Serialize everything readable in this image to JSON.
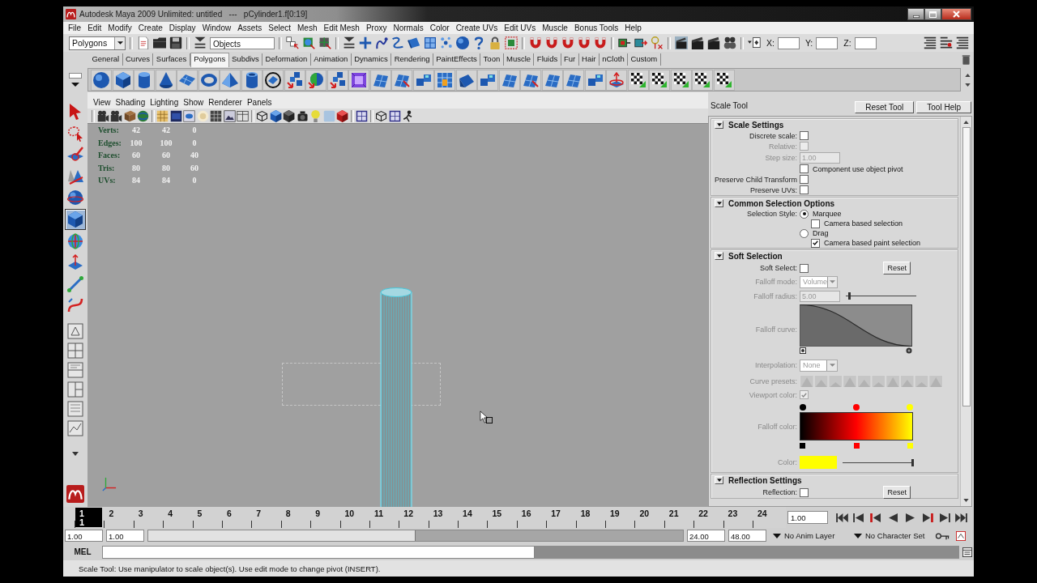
{
  "window": {
    "title": "Autodesk Maya 2009 Unlimited: untitled   ---   pCylinder1.f[0:19]"
  },
  "menu_bar": [
    "File",
    "Edit",
    "Modify",
    "Create",
    "Display",
    "Window",
    "Assets",
    "Select",
    "Mesh",
    "Edit Mesh",
    "Proxy",
    "Normals",
    "Color",
    "Create UVs",
    "Edit UVs",
    "Muscle",
    "Bonus Tools",
    "Help"
  ],
  "status_line": {
    "menu_set": "Polygons",
    "selection_mode": "Objects",
    "coordinate_labels": [
      "X:",
      "Y:",
      "Z:"
    ]
  },
  "shelf": {
    "tabs": [
      {
        "label": "General",
        "selected": false
      },
      {
        "label": "Curves",
        "selected": false
      },
      {
        "label": "Surfaces",
        "selected": false
      },
      {
        "label": "Polygons",
        "selected": true
      },
      {
        "label": "Subdivs",
        "selected": false
      },
      {
        "label": "Deformation",
        "selected": false
      },
      {
        "label": "Animation",
        "selected": false
      },
      {
        "label": "Dynamics",
        "selected": false
      },
      {
        "label": "Rendering",
        "selected": false
      },
      {
        "label": "PaintEffects",
        "selected": false
      },
      {
        "label": "Toon",
        "selected": false
      },
      {
        "label": "Muscle",
        "selected": false
      },
      {
        "label": "Fluids",
        "selected": false
      },
      {
        "label": "Fur",
        "selected": false
      },
      {
        "label": "Hair",
        "selected": false
      },
      {
        "label": "nCloth",
        "selected": false
      },
      {
        "label": "Custom",
        "selected": false
      }
    ]
  },
  "toolbox": {
    "tools": [
      {
        "selected": false
      },
      {
        "selected": false
      },
      {
        "selected": false
      },
      {
        "selected": false
      },
      {
        "selected": false
      },
      {
        "selected": true
      },
      {
        "selected": false
      },
      {
        "selected": false
      },
      {
        "selected": false
      },
      {
        "selected": false
      }
    ]
  },
  "viewport": {
    "menu": [
      "View",
      "Shading",
      "Lighting",
      "Show",
      "Renderer",
      "Panels"
    ],
    "stats": [
      {
        "label": "Verts:",
        "values": [
          "42",
          "42",
          "0"
        ]
      },
      {
        "label": "Edges:",
        "values": [
          "100",
          "100",
          "0"
        ]
      },
      {
        "label": "Faces:",
        "values": [
          "60",
          "60",
          "40"
        ]
      },
      {
        "label": "Tris:",
        "values": [
          "80",
          "80",
          "60"
        ]
      },
      {
        "label": "UVs:",
        "values": [
          "84",
          "84",
          "0"
        ]
      }
    ]
  },
  "tool_settings": {
    "title": "Scale Tool",
    "buttons": [
      "Reset Tool",
      "Tool Help"
    ],
    "sections": [
      {
        "title": "Scale Settings",
        "expanded": true,
        "rows": [
          {
            "kind": "checkbox",
            "label": "Discrete scale:",
            "checked": false,
            "disabled": false
          },
          {
            "kind": "checkbox",
            "label": "Relative:",
            "checked": false,
            "disabled": true
          },
          {
            "kind": "field",
            "label": "Step size:",
            "value": "1.00",
            "disabled": true
          },
          {
            "kind": "option",
            "text": "Component use object pivot",
            "checked": false,
            "disabled": false
          },
          {
            "kind": "checkbox",
            "label": "Preserve Child Transform",
            "checked": false,
            "disabled": false
          },
          {
            "kind": "checkbox",
            "label": "Preserve UVs:",
            "checked": false,
            "disabled": false
          }
        ]
      },
      {
        "title": "Common Selection Options",
        "expanded": true,
        "rows": [
          {
            "kind": "radio",
            "label": "Selection Style:",
            "text": "Marquee",
            "selected": true,
            "disabled": false
          },
          {
            "kind": "sub_option",
            "text": "Camera based selection",
            "checked": false,
            "disabled": false
          },
          {
            "kind": "radio",
            "text": "Drag",
            "selected": false,
            "disabled": false
          },
          {
            "kind": "sub_option",
            "text": "Camera based paint selection",
            "checked": true,
            "disabled": false
          }
        ]
      },
      {
        "title": "Soft Selection",
        "expanded": true,
        "rows": [
          {
            "kind": "checkbox",
            "label": "Soft Select:",
            "checked": false,
            "disabled": false,
            "button": "Reset"
          },
          {
            "kind": "dropdown",
            "label": "Falloff mode:",
            "value": "Volume",
            "disabled": true
          },
          {
            "kind": "slider_field",
            "label": "Falloff radius:",
            "value": "5.00",
            "level": 0.05,
            "disabled": true
          },
          {
            "kind": "curve",
            "label": "Falloff curve:",
            "disabled": true
          },
          {
            "kind": "dropdown",
            "label": "Interpolation:",
            "value": "None",
            "disabled": true
          },
          {
            "kind": "presets",
            "label": "Curve presets:",
            "disabled": true
          },
          {
            "kind": "checkbox",
            "label": "Viewport color:",
            "checked": true,
            "disabled": true
          },
          {
            "kind": "gradient",
            "label": "Falloff color:",
            "stops": [
              {
                "color": "#000000"
              },
              {
                "color": "#ff0000"
              },
              {
                "color": "#ffff00"
              }
            ],
            "disabled": true
          },
          {
            "kind": "color_slider",
            "label": "Color:",
            "color": "#ffff00",
            "level": 1,
            "disabled": true
          }
        ]
      },
      {
        "title": "Reflection Settings",
        "expanded": true,
        "rows": [
          {
            "kind": "checkbox",
            "label": "Reflection:",
            "checked": false,
            "disabled": false,
            "button": "Reset"
          }
        ]
      }
    ]
  },
  "time_slider": {
    "frames": [
      {
        "label": "1",
        "selected": true
      },
      {
        "label": "2",
        "selected": false
      },
      {
        "label": "3",
        "selected": false
      },
      {
        "label": "4",
        "selected": false
      },
      {
        "label": "5",
        "selected": false
      },
      {
        "label": "6",
        "selected": false
      },
      {
        "label": "7",
        "selected": false
      },
      {
        "label": "8",
        "selected": false
      },
      {
        "label": "9",
        "selected": false
      },
      {
        "label": "10",
        "selected": false
      },
      {
        "label": "11",
        "selected": false
      },
      {
        "label": "12",
        "selected": false
      },
      {
        "label": "13",
        "selected": false
      },
      {
        "label": "14",
        "selected": false
      },
      {
        "label": "15",
        "selected": false
      },
      {
        "label": "16",
        "selected": false
      },
      {
        "label": "17",
        "selected": false
      },
      {
        "label": "18",
        "selected": false
      },
      {
        "label": "19",
        "selected": false
      },
      {
        "label": "20",
        "selected": false
      },
      {
        "label": "21",
        "selected": false
      },
      {
        "label": "22",
        "selected": false
      },
      {
        "label": "23",
        "selected": false
      },
      {
        "label": "24",
        "selected": false
      }
    ],
    "current_frame": "1",
    "current_time": "1.00"
  },
  "range_slider": {
    "start_time": "1.00",
    "range_start": "1.00",
    "level": 0.5,
    "range_end": "24.00",
    "end_time": "48.00",
    "anim_layer": "No Anim Layer",
    "character_set": "No Character Set"
  },
  "command_line": {
    "language": "MEL"
  },
  "help_line": "Scale Tool: Use manipulator to scale object(s). Use edit mode to change pivot (INSERT)."
}
